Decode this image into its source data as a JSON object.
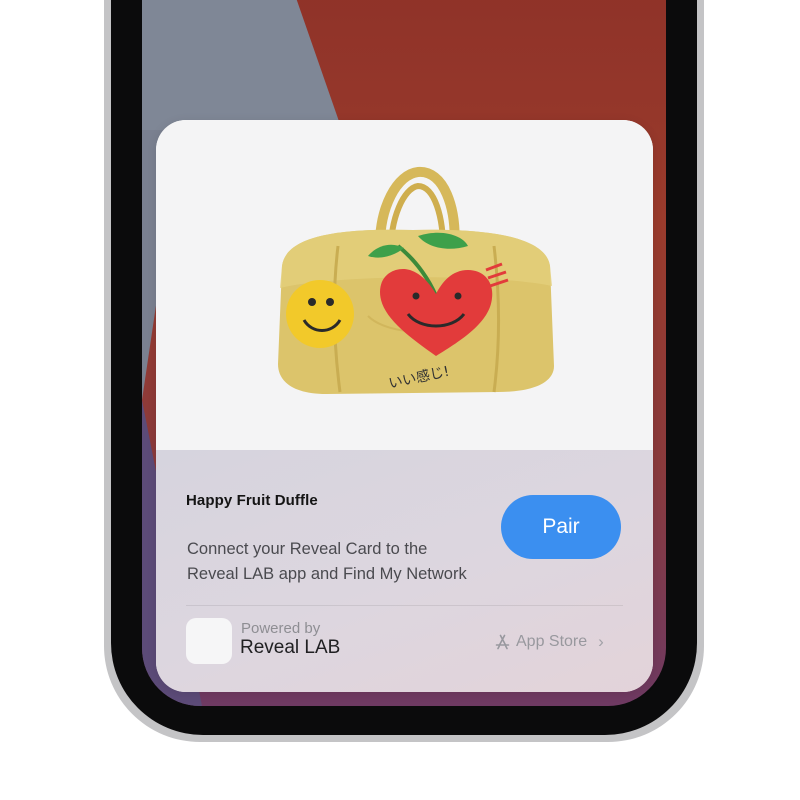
{
  "card": {
    "product_image": "happy-fruit-duffle-bag",
    "product_title": "Happy Fruit Duffle",
    "description_line1": "Connect your Reveal Card to the",
    "description_line2": "Reveal LAB app and Find My Network",
    "pair_button_label": "Pair"
  },
  "footer": {
    "app_icon": "app-icon-placeholder",
    "powered_by_label": "Powered by",
    "app_name": "Reveal LAB",
    "store_icon": "app-store-icon",
    "store_link_label": "App Store",
    "chevron_icon": "chevron-right-icon"
  },
  "colors": {
    "accent": "#3b8ff0",
    "wallpaper_red": "#8b2f27",
    "wallpaper_slate": "#7f8796",
    "wallpaper_purple": "#6f3a63"
  }
}
